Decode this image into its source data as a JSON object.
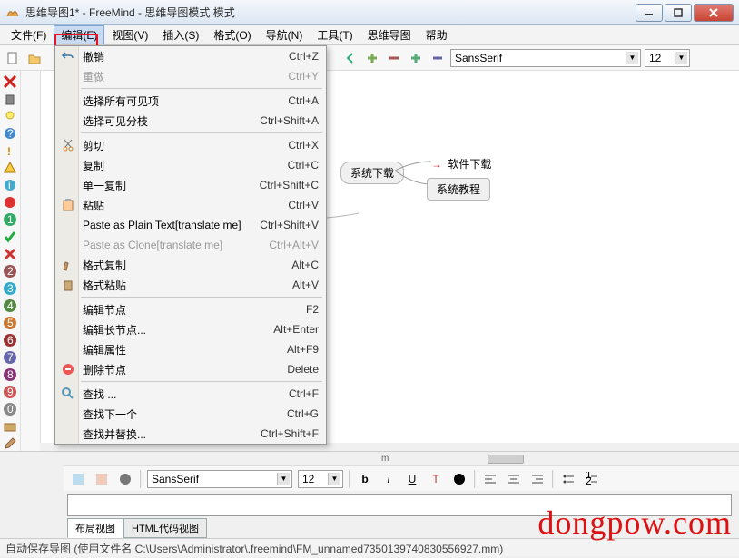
{
  "title": "思维导图1* - FreeMind - 思维导图模式 模式",
  "menubar": [
    "文件(F)",
    "编辑(E)",
    "视图(V)",
    "插入(S)",
    "格式(O)",
    "导航(N)",
    "工具(T)",
    "思维导图",
    "帮助"
  ],
  "menubar_open_index": 1,
  "dropdown": [
    {
      "label": "撤销",
      "shortcut": "Ctrl+Z",
      "icon": "undo-icon"
    },
    {
      "label": "重做",
      "shortcut": "Ctrl+Y",
      "disabled": true
    },
    {
      "sep": true
    },
    {
      "label": "选择所有可见项",
      "shortcut": "Ctrl+A"
    },
    {
      "label": "选择可见分枝",
      "shortcut": "Ctrl+Shift+A"
    },
    {
      "sep": true
    },
    {
      "label": "剪切",
      "shortcut": "Ctrl+X",
      "icon": "cut-icon"
    },
    {
      "label": "复制",
      "shortcut": "Ctrl+C"
    },
    {
      "label": "单一复制",
      "shortcut": "Ctrl+Shift+C"
    },
    {
      "label": "粘贴",
      "shortcut": "Ctrl+V",
      "icon": "paste-icon"
    },
    {
      "label": "Paste as Plain Text[translate me]",
      "shortcut": "Ctrl+Shift+V"
    },
    {
      "label": "Paste as Clone[translate me]",
      "shortcut": "Ctrl+Alt+V",
      "disabled": true
    },
    {
      "label": "格式复制",
      "shortcut": "Alt+C",
      "icon": "format-copy-icon"
    },
    {
      "label": "格式粘贴",
      "shortcut": "Alt+V",
      "icon": "format-paste-icon"
    },
    {
      "sep": true
    },
    {
      "label": "编辑节点",
      "shortcut": "F2"
    },
    {
      "label": "编辑长节点...",
      "shortcut": "Alt+Enter"
    },
    {
      "label": "编辑属性",
      "shortcut": "Alt+F9"
    },
    {
      "label": "删除节点",
      "shortcut": "Delete",
      "icon": "delete-icon"
    },
    {
      "sep": true
    },
    {
      "label": "查找 ...",
      "shortcut": "Ctrl+F",
      "icon": "find-icon"
    },
    {
      "label": "查找下一个",
      "shortcut": "Ctrl+G"
    },
    {
      "label": "查找并替换...",
      "shortcut": "Ctrl+Shift+F"
    }
  ],
  "toolbar_top": {
    "font": "SansSerif",
    "size": "12"
  },
  "canvas_nodes": {
    "root": "系统下载",
    "children": [
      "软件下载",
      "系统教程"
    ]
  },
  "toolbar_bottom": {
    "style": "",
    "font": "SansSerif",
    "size": "12"
  },
  "tabs": [
    "布局视图",
    "HTML代码视图"
  ],
  "active_tab": 0,
  "status": "自动保存导图 (使用文件名 C:\\Users\\Administrator\\.freemind\\FM_unnamed7350139740830556927.mm)",
  "scroll_label": "m",
  "watermark": "dongpow.com"
}
